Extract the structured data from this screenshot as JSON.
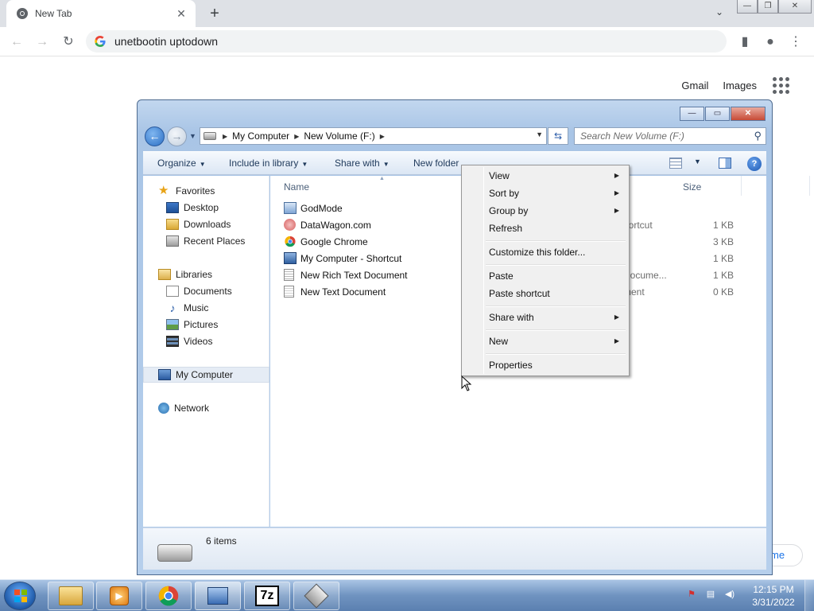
{
  "browser": {
    "tab_title": "New Tab",
    "tab_close": "✕",
    "new_tab": "+",
    "omnibox_text": "unetbootin uptodown",
    "gmail": "Gmail",
    "images": "Images",
    "customize_peek": "me"
  },
  "explorer": {
    "breadcrumb": [
      "My Computer",
      "New Volume (F:)"
    ],
    "search_placeholder": "Search New Volume (F:)",
    "commands": {
      "organize": "Organize",
      "include_in_library": "Include in library",
      "share_with": "Share with",
      "new_folder": "New folder"
    },
    "columns": {
      "name": "Name",
      "size": "Size"
    },
    "nav": {
      "favorites": "Favorites",
      "desktop": "Desktop",
      "downloads": "Downloads",
      "recent_places": "Recent Places",
      "libraries": "Libraries",
      "documents": "Documents",
      "music": "Music",
      "pictures": "Pictures",
      "videos": "Videos",
      "my_computer": "My Computer",
      "network": "Network"
    },
    "files": [
      {
        "name": "GodMode",
        "type": "",
        "size": "",
        "icon": "control-panel-icon"
      },
      {
        "name": "DataWagon.com",
        "type": "hortcut",
        "size": "1 KB",
        "icon": "internet-shortcut-icon"
      },
      {
        "name": "Google Chrome",
        "type": "",
        "size": "3 KB",
        "icon": "chrome-icon"
      },
      {
        "name": "My Computer - Shortcut",
        "type": "",
        "size": "1 KB",
        "icon": "computer-shortcut-icon"
      },
      {
        "name": "New Rich Text Document",
        "type": "Docume...",
        "size": "1 KB",
        "icon": "rtf-document-icon"
      },
      {
        "name": "New Text Document",
        "type": "ment",
        "size": "0 KB",
        "icon": "text-document-icon"
      }
    ],
    "details": "6 items"
  },
  "context_menu": {
    "view": "View",
    "sort_by": "Sort by",
    "group_by": "Group by",
    "refresh": "Refresh",
    "customize": "Customize this folder...",
    "paste": "Paste",
    "paste_shortcut": "Paste shortcut",
    "share_with": "Share with",
    "new": "New",
    "properties": "Properties"
  },
  "taskbar": {
    "time": "12:15 PM",
    "date": "3/31/2022",
    "apps": [
      "explorer-icon",
      "media-player-icon",
      "chrome-icon",
      "computer-icon",
      "7zip-icon",
      "usb-drive-icon"
    ],
    "seven_zip_label": "7z"
  },
  "colors": {
    "chrome_tabstrip": "#dee1e6",
    "explorer_frame": "#b6cfec",
    "taskbar": "#6f93c0",
    "context_menu": "#f0f0f0"
  }
}
